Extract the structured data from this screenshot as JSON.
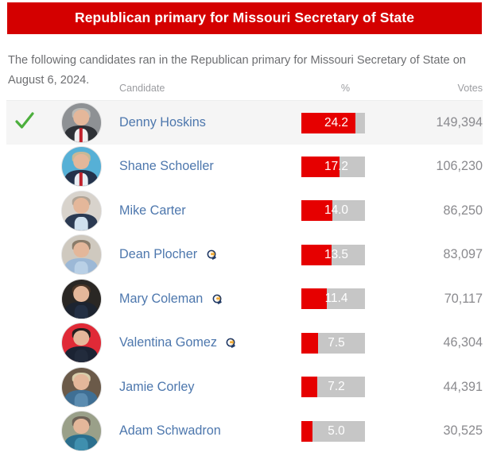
{
  "banner": {
    "title": "Republican primary for Missouri Secretary of State",
    "color": "#d40000"
  },
  "intro": {
    "text": "The following candidates ran in the Republican primary for Missouri Secretary of State on August 6, 2024."
  },
  "table": {
    "headers": {
      "candidate": "Candidate",
      "percent": "%",
      "votes": "Votes"
    },
    "accent_color": "#e60000",
    "track_color": "#c6c6c6",
    "link_color": "#4d77ad",
    "winner_highlight": "#f5f5f5",
    "check_color": "#4caf3d",
    "rows": [
      {
        "name": "Denny Hoskins",
        "percent": "24.2",
        "percent_value": 24.2,
        "votes": "149,394",
        "winner": true,
        "check_icon": "check-icon",
        "candidate_connection": false,
        "avatar": {
          "icon": "avatar",
          "bg": "#8e9194",
          "hair": "#b9b9b6",
          "body": "#2e3136",
          "shirt": "#f0f0f0",
          "tie": true
        }
      },
      {
        "name": "Shane Schoeller",
        "percent": "17.2",
        "percent_value": 17.2,
        "votes": "106,230",
        "winner": false,
        "check_icon": null,
        "candidate_connection": false,
        "avatar": {
          "icon": "avatar",
          "bg": "#56b0d6",
          "hair": "#c8b896",
          "body": "#24324b",
          "shirt": "#e8eef4",
          "tie": true
        }
      },
      {
        "name": "Mike Carter",
        "percent": "14.0",
        "percent_value": 14.0,
        "votes": "86,250",
        "winner": false,
        "check_icon": null,
        "candidate_connection": false,
        "avatar": {
          "icon": "avatar",
          "bg": "#d8d3cc",
          "hair": "#b0a496",
          "body": "#2b3a52",
          "shirt": "#cfe0ee",
          "tie": false
        }
      },
      {
        "name": "Dean Plocher",
        "percent": "13.5",
        "percent_value": 13.5,
        "votes": "83,097",
        "winner": false,
        "check_icon": null,
        "candidate_connection": true,
        "avatar": {
          "icon": "avatar",
          "bg": "#cfc9bf",
          "hair": "#8a7c6a",
          "body": "#9cb8d6",
          "shirt": "#b9d0e6",
          "tie": false
        }
      },
      {
        "name": "Mary Coleman",
        "percent": "11.4",
        "percent_value": 11.4,
        "votes": "70,117",
        "winner": false,
        "check_icon": null,
        "candidate_connection": true,
        "avatar": {
          "icon": "avatar",
          "bg": "#2a2724",
          "hair": "#4a3526",
          "body": "#1d2430",
          "shirt": "#243044",
          "tie": false
        }
      },
      {
        "name": "Valentina Gomez",
        "percent": "7.5",
        "percent_value": 7.5,
        "votes": "46,304",
        "winner": false,
        "check_icon": null,
        "candidate_connection": true,
        "avatar": {
          "icon": "avatar",
          "bg": "#e02a37",
          "hair": "#23201f",
          "body": "#1b2333",
          "shirt": "#222b3c",
          "tie": false
        }
      },
      {
        "name": "Jamie Corley",
        "percent": "7.2",
        "percent_value": 7.2,
        "votes": "44,391",
        "winner": false,
        "check_icon": null,
        "candidate_connection": false,
        "avatar": {
          "icon": "avatar",
          "bg": "#6b5a49",
          "hair": "#d8cdaa",
          "body": "#3f6f94",
          "shirt": "#5b8cb0",
          "tie": false
        }
      },
      {
        "name": "Adam Schwadron",
        "percent": "5.0",
        "percent_value": 5.0,
        "votes": "30,525",
        "winner": false,
        "check_icon": null,
        "candidate_connection": false,
        "avatar": {
          "icon": "avatar",
          "bg": "#9aa089",
          "hair": "#6d6257",
          "body": "#2b6f8e",
          "shirt": "#3f8fae",
          "tie": false
        }
      }
    ]
  }
}
